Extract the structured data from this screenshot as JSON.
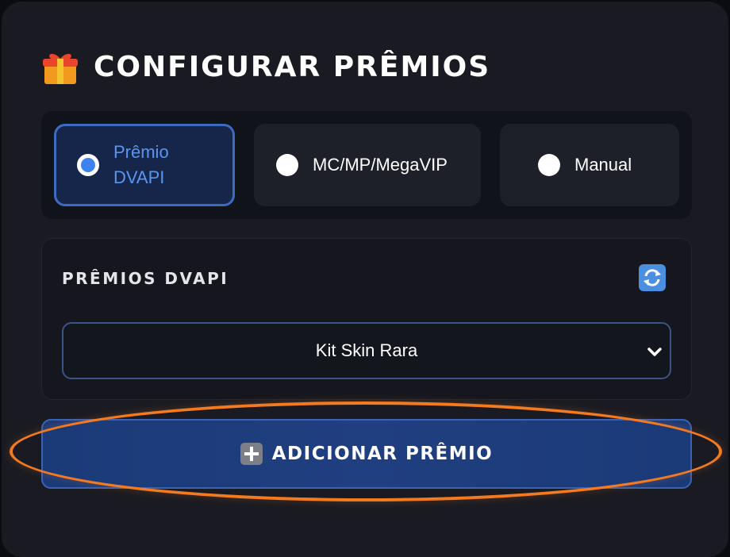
{
  "header": {
    "title": "CONFIGURAR PRÊMIOS",
    "icon": "gift-icon"
  },
  "mode_selector": {
    "options": [
      {
        "line1": "Prêmio",
        "line2": "DVAPI",
        "selected": true
      },
      {
        "label": "MC/MP/MegaVIP",
        "selected": false
      },
      {
        "label": "Manual",
        "selected": false
      }
    ],
    "accent": "#3d82f0"
  },
  "dvapi_section": {
    "title": "PRÊMIOS DVAPI",
    "refresh_icon": "refresh-icon",
    "select": {
      "value": "Kit Skin Rara"
    }
  },
  "add_button": {
    "label": "ADICIONAR PRÊMIO",
    "icon": "plus-icon"
  },
  "annotation": {
    "highlight_color": "#f47a20"
  }
}
